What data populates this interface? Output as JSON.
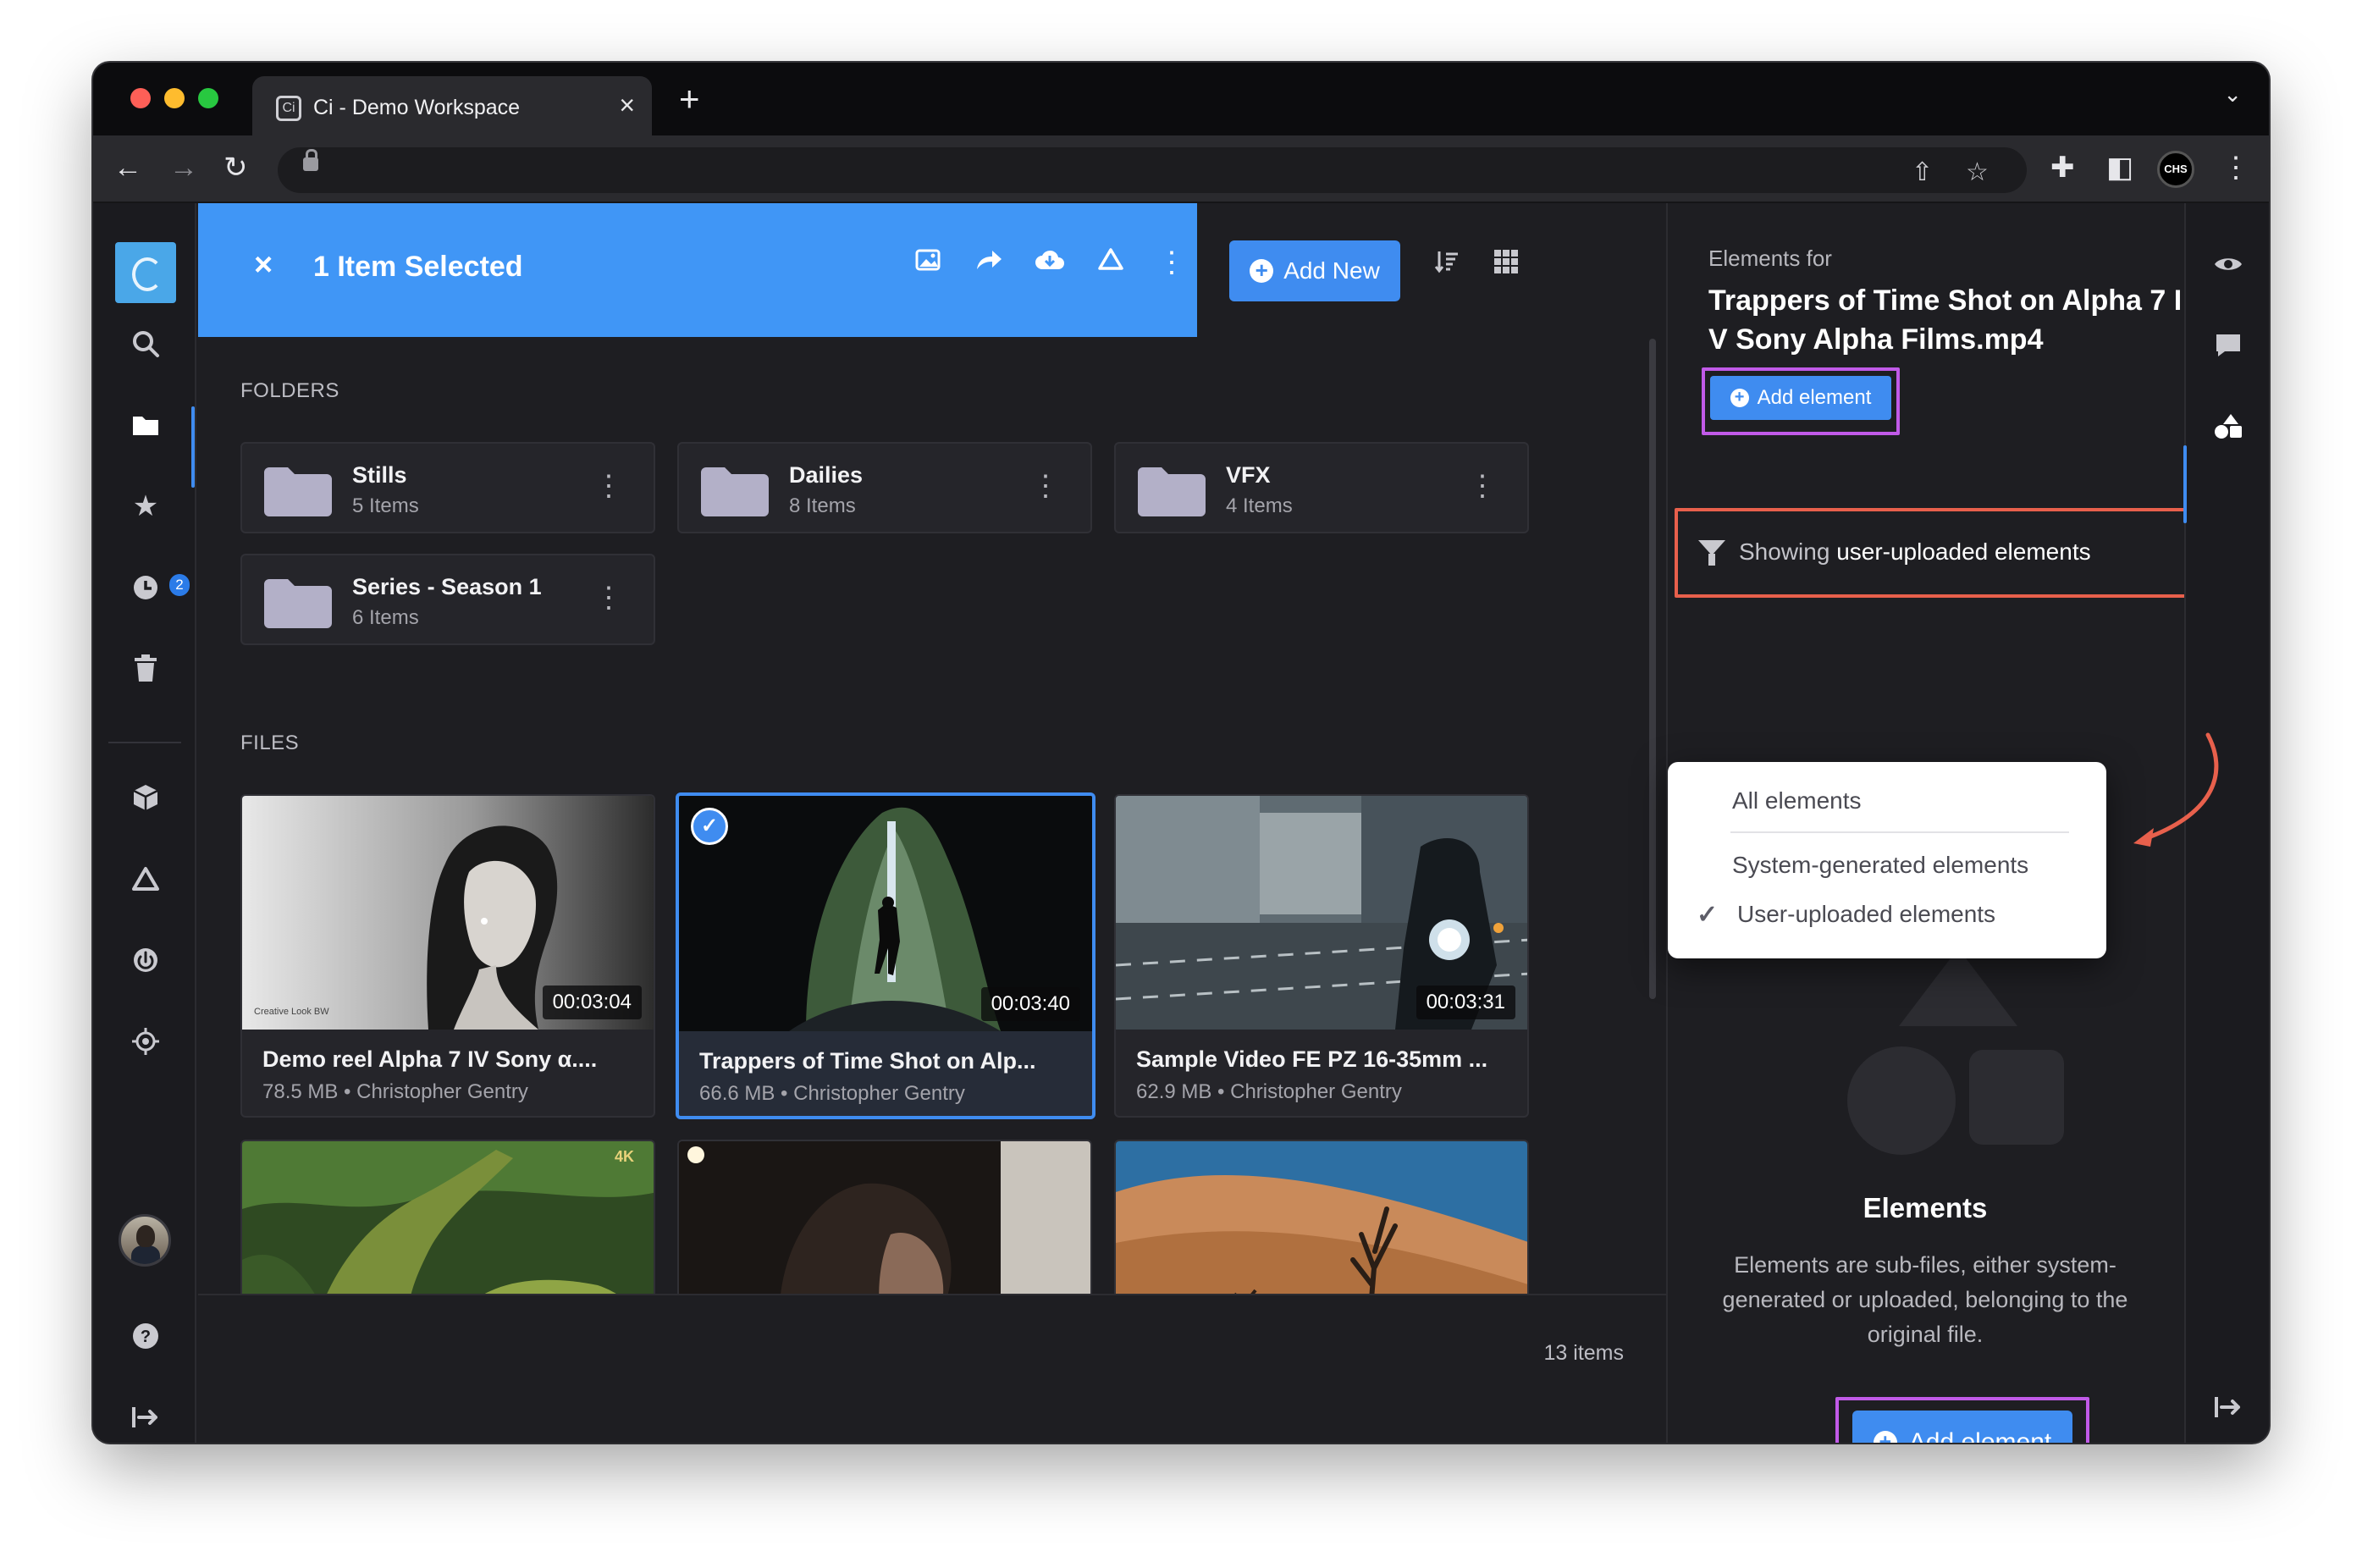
{
  "browser": {
    "tab_title": "Ci - Demo Workspace",
    "favicon_text": "Ci",
    "new_tab": "+",
    "close_tab": "×",
    "profile_text": "CHS"
  },
  "colors": {
    "accent": "#3f8cf0",
    "selection_bar": "#4096f6",
    "highlight_purple": "#c15ae8",
    "highlight_red": "#e8604c"
  },
  "nav": {
    "items": [
      {
        "name": "search-icon"
      },
      {
        "name": "folder-icon"
      },
      {
        "name": "star-icon"
      },
      {
        "name": "clock-icon"
      },
      {
        "name": "trash-icon"
      },
      {
        "name": "cube-icon"
      },
      {
        "name": "triangle-icon"
      },
      {
        "name": "power-icon"
      },
      {
        "name": "target-icon"
      },
      {
        "name": "help-icon"
      },
      {
        "name": "logout-icon"
      }
    ],
    "recent_badge": "2"
  },
  "selection": {
    "label": "1 Item Selected",
    "close": "×"
  },
  "actions": {
    "add_new": "Add New",
    "add_new_plus": "+"
  },
  "folders_section": {
    "heading": "FOLDERS",
    "items": [
      {
        "name": "Stills",
        "count": "5 Items"
      },
      {
        "name": "Dailies",
        "count": "8 Items"
      },
      {
        "name": "VFX",
        "count": "4 Items"
      },
      {
        "name": "Series - Season 1",
        "count": "6 Items"
      }
    ]
  },
  "files_section": {
    "heading": "FILES",
    "items": [
      {
        "title": "Demo reel Alpha 7 IV Sony α....",
        "meta": "78.5 MB • Christopher Gentry",
        "duration": "00:03:04",
        "thumb_caption": "Creative Look BW"
      },
      {
        "title": "Trappers of Time Shot on Alp...",
        "meta": "66.6 MB • Christopher Gentry",
        "duration": "00:03:40",
        "selected": true
      },
      {
        "title": "Sample Video FE PZ 16-35mm ...",
        "meta": "62.9 MB • Christopher Gentry",
        "duration": "00:03:31"
      }
    ],
    "thumb_badge_4k": "4K"
  },
  "footer": {
    "items_count": "13 items"
  },
  "panel": {
    "elements_for": "Elements for",
    "file_title": "Trappers of Time Shot on Alpha 7 IV Sony Alpha Films.mp4",
    "add_element": "Add element",
    "filter_prefix": "Showing",
    "filter_value": "user-uploaded elements",
    "dropdown": {
      "options": [
        "All elements",
        "System-generated elements",
        "User-uploaded elements"
      ],
      "selected": "User-uploaded elements"
    },
    "empty_title": "Elements",
    "empty_desc": "Elements are sub-files, either system-generated or uploaded, belonging to the original file.",
    "add_element_big": "Add element"
  },
  "rail": {
    "items": [
      {
        "name": "eye-icon"
      },
      {
        "name": "comment-icon"
      },
      {
        "name": "shapes-icon"
      },
      {
        "name": "logout-icon"
      }
    ]
  }
}
